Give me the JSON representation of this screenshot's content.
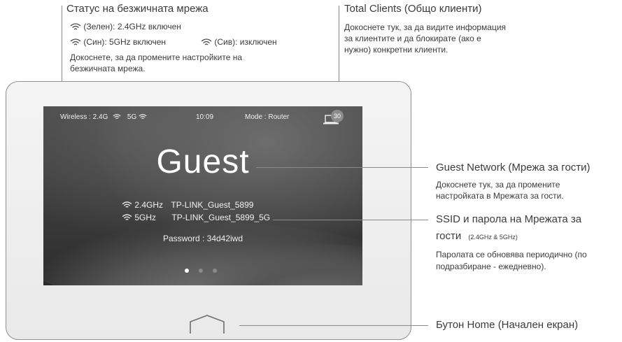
{
  "callouts": {
    "wireless_status": {
      "title": "Статус на безжичната мрежа",
      "green_line": "(Зелен): 2.4GHz включен",
      "blue_line": "(Син): 5GHz включен",
      "gray_line": "(Сив): изключен",
      "desc_1": "Докоснете, за да промените настройките на",
      "desc_2": "безжичната мрежа."
    },
    "total_clients": {
      "title": "Total Clients (Общо клиенти)",
      "desc_1": "Докоснете тук, за да видите информация",
      "desc_2": "за клиентите и да блокирате (ако е",
      "desc_3": "нужно) конкретни клиенти."
    },
    "guest_network": {
      "title": "Guest Network (Мрежа за гости)",
      "desc_1": "Докоснете тук, за да промените",
      "desc_2": "настройката в Мрежата за гости."
    },
    "ssid_password": {
      "title_1": "SSID и парола на Мрежата за",
      "title_2": "гости",
      "title_note": "(2.4GHz & 5GHz)",
      "desc_1": "Паролата се обновява периодично (по",
      "desc_2": "подразбиране - ежедневно)."
    },
    "home_button": {
      "title": "Бутон Home (Начален екран)"
    }
  },
  "screen": {
    "status": {
      "wireless_24": "Wireless : 2.4G",
      "wireless_5": "5G",
      "time": "10:09",
      "mode": "Mode : Router",
      "clients_count": "30"
    },
    "title": "Guest",
    "ssid_24_band": "2.4GHz",
    "ssid_24_name": "TP-LINK_Guest_5899",
    "ssid_5_band": "5GHz",
    "ssid_5_name": "TP-LINK_Guest_5899_5G",
    "password": "Password : 34d42iwd",
    "active_page": 1,
    "page_count": 3
  },
  "icons": {
    "wifi": "wifi-icon",
    "laptop": "laptop-icon",
    "home": "home-icon"
  },
  "colors": {
    "screen_bg": "#3f3f3f",
    "leader_line": "#8a8a8a",
    "text": "#3b3b3b"
  }
}
